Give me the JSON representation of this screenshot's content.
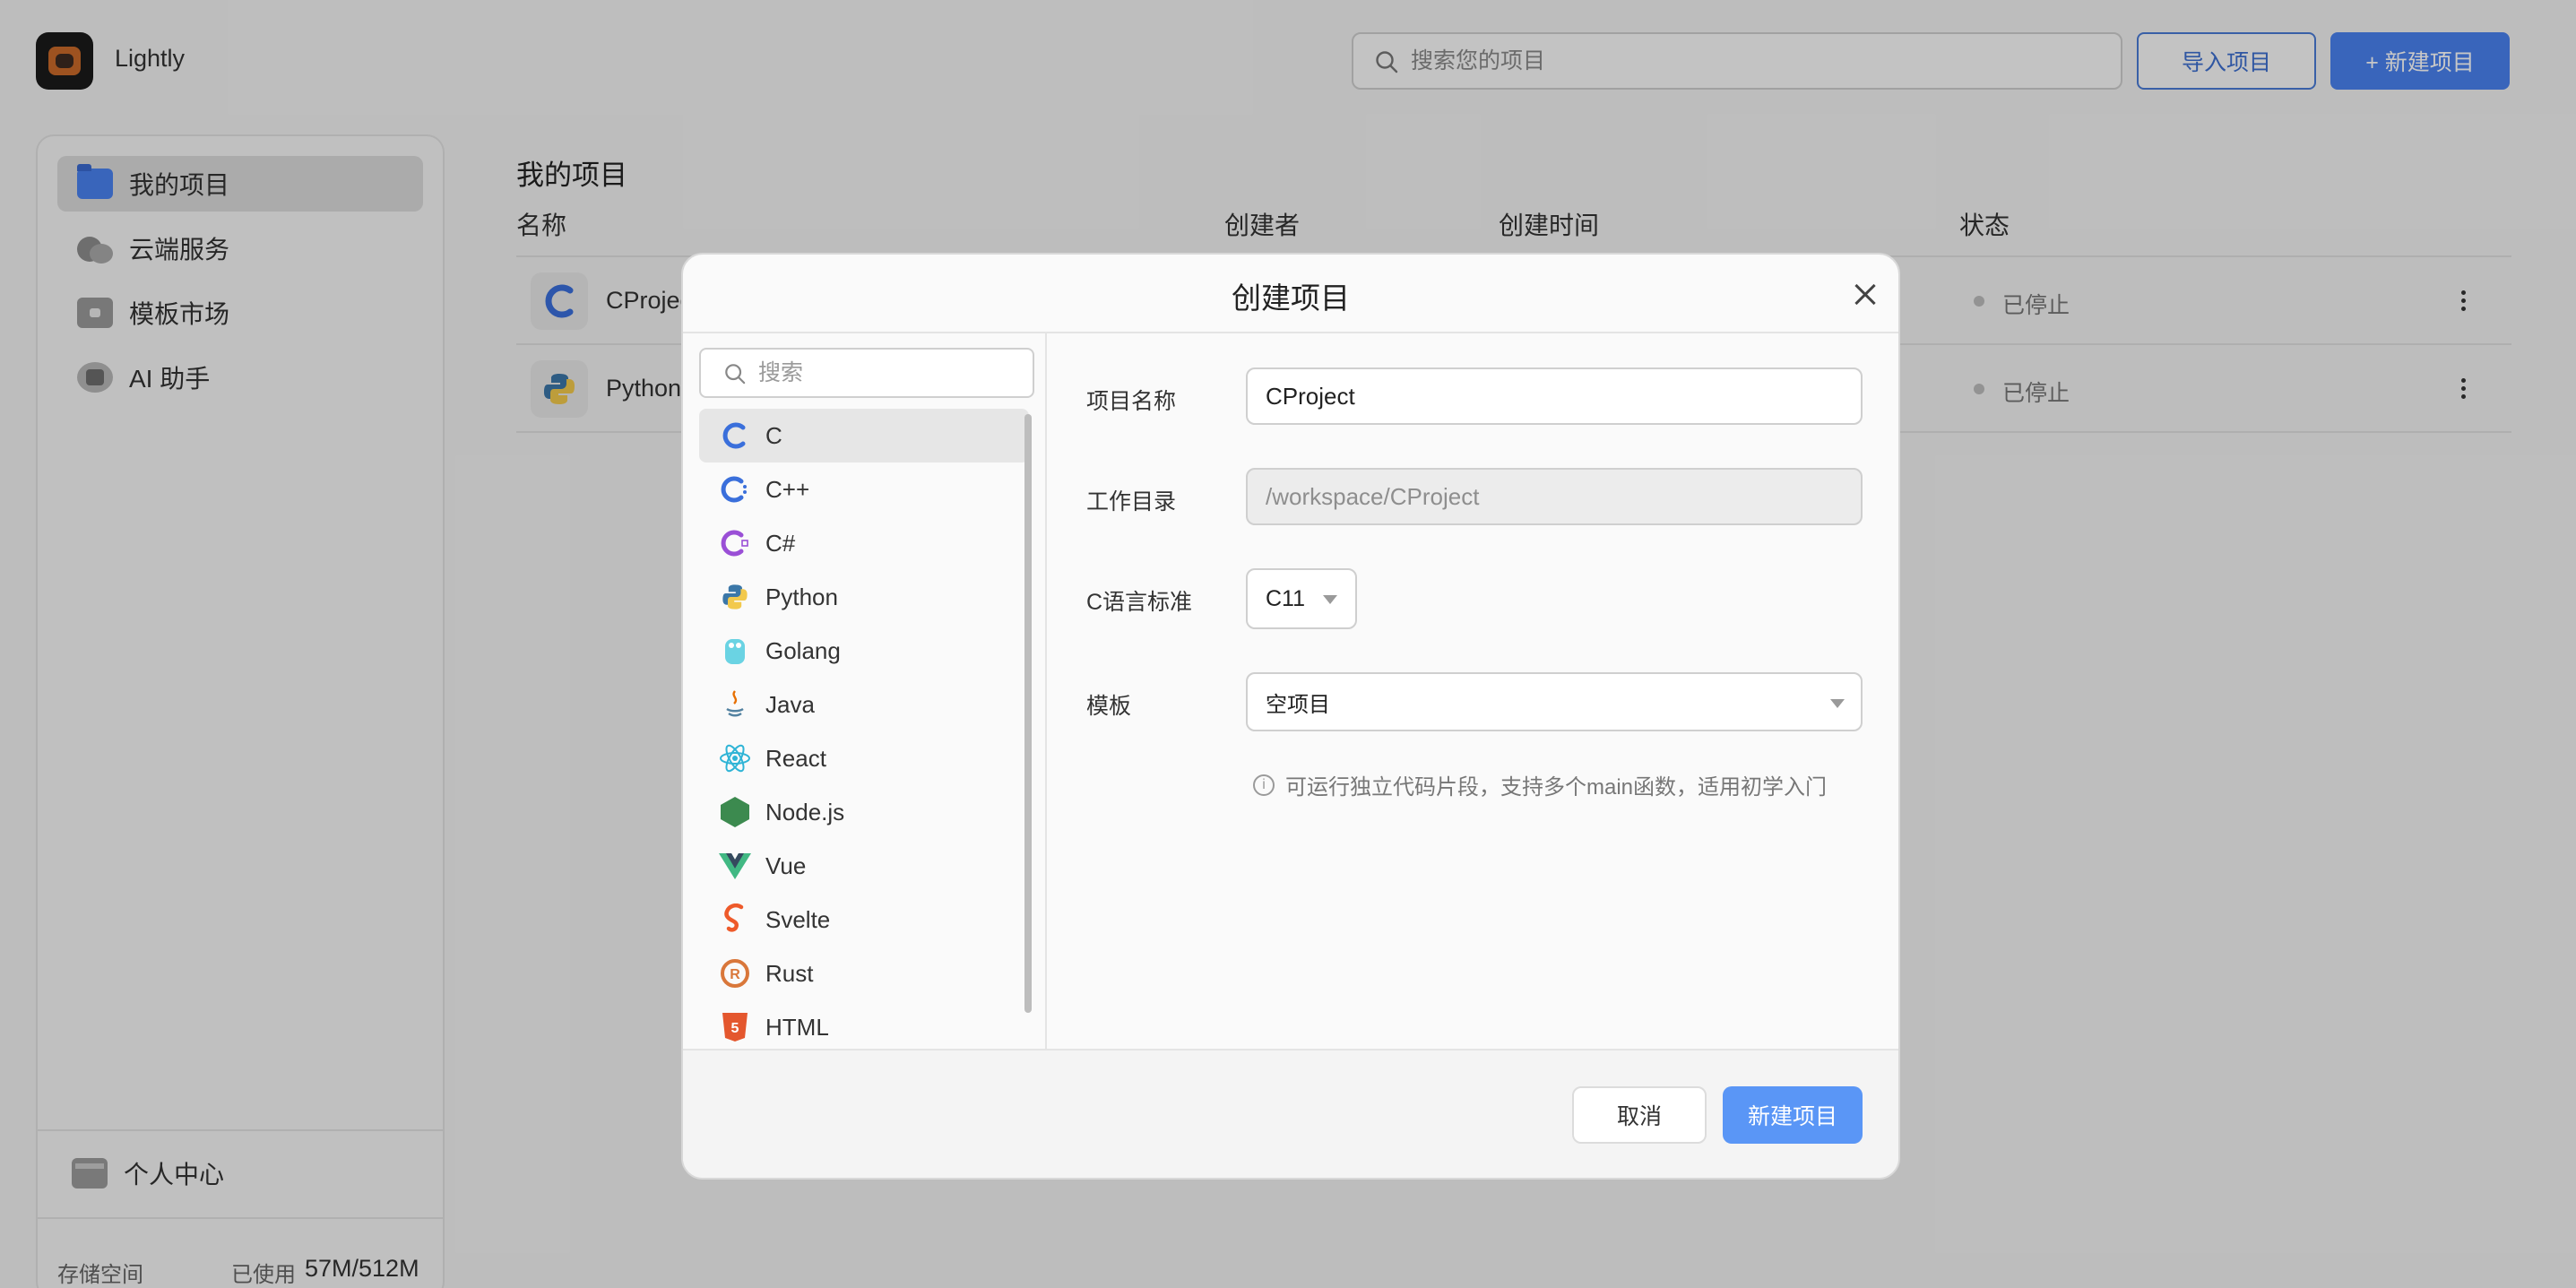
{
  "app": {
    "title": "Lightly"
  },
  "header": {
    "search_placeholder": "搜索您的项目",
    "import_label": "导入项目",
    "new_label": "+ 新建项目"
  },
  "sidebar": {
    "items": [
      {
        "label": "我的项目",
        "icon": "folder-icon",
        "active": true
      },
      {
        "label": "云端服务",
        "icon": "cloud-icon",
        "active": false
      },
      {
        "label": "模板市场",
        "icon": "market-icon",
        "active": false
      },
      {
        "label": "AI 助手",
        "icon": "robot-icon",
        "active": false
      }
    ],
    "profile_label": "个人中心",
    "storage_label": "存储空间",
    "storage_used_label": "已使用",
    "storage_value": "57M/512M"
  },
  "main": {
    "title": "我的项目",
    "columns": [
      "名称",
      "创建者",
      "创建时间",
      "状态"
    ],
    "rows": [
      {
        "name": "CProjec",
        "icon": "c-lang-icon",
        "status": "已停止"
      },
      {
        "name": "PythonI",
        "icon": "python-icon",
        "status": "已停止"
      }
    ]
  },
  "modal": {
    "title": "创建项目",
    "search_placeholder": "搜索",
    "languages": [
      "C",
      "C++",
      "C#",
      "Python",
      "Golang",
      "Java",
      "React",
      "Node.js",
      "Vue",
      "Svelte",
      "Rust",
      "HTML"
    ],
    "selected_language": "C",
    "form": {
      "name_label": "项目名称",
      "name_value": "CProject",
      "dir_label": "工作目录",
      "dir_value": "/workspace/CProject",
      "std_label": "C语言标准",
      "std_value": "C11",
      "template_label": "模板",
      "template_value": "空项目",
      "hint": "可运行独立代码片段，支持多个main函数，适用初学入门"
    },
    "cancel_label": "取消",
    "create_label": "新建项目"
  },
  "colors": {
    "accent": "#4a82f0",
    "primary_button": "#5a96f6",
    "c_blue": "#3a6fdb",
    "python_blue": "#3b77a8",
    "python_yellow": "#f2c94c",
    "csharp_purple": "#9a4fd6",
    "react_cyan": "#2fb4d6",
    "node_green": "#3c8a4f",
    "vue_green": "#41b883",
    "svelte_orange": "#ee5a2a",
    "rust_orange": "#d9773a",
    "html_orange": "#e4572e"
  }
}
